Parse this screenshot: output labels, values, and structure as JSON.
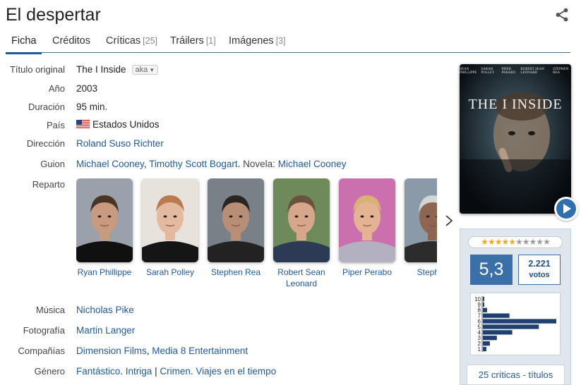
{
  "title": "El despertar",
  "tabs": [
    {
      "label": "Ficha",
      "count": ""
    },
    {
      "label": "Créditos",
      "count": ""
    },
    {
      "label": "Críticas",
      "count": "[25]"
    },
    {
      "label": "Tráilers",
      "count": "[1]"
    },
    {
      "label": "Imágenes",
      "count": "[3]"
    }
  ],
  "labels": {
    "original_title": "Título original",
    "year": "Año",
    "duration": "Duración",
    "country": "País",
    "director": "Dirección",
    "screenplay": "Guion",
    "cast": "Reparto",
    "music": "Música",
    "photography": "Fotografía",
    "companies": "Compañías",
    "genre": "Género"
  },
  "values": {
    "original_title": "The I Inside",
    "aka_label": "aka",
    "year": "2003",
    "duration": "95 min.",
    "country": "Estados Unidos",
    "director": "Roland Suso Richter",
    "screenplay_writers": [
      "Michael Cooney",
      "Timothy Scott Bogart"
    ],
    "novel_label": "Novela:",
    "novel_author": "Michael Cooney",
    "music": "Nicholas Pike",
    "photography": "Martin Langer",
    "companies": [
      "Dimension Films",
      "Media 8 Entertainment"
    ],
    "genre_a": [
      "Fantástico",
      "Intriga"
    ],
    "genre_b": [
      "Crimen",
      "Viajes en el tiempo"
    ]
  },
  "cast": [
    {
      "name": "Ryan Phillippe",
      "skin": "#c89a80",
      "hair": "#4a3426",
      "bg": "#9aa1ab",
      "shirt": "#101010"
    },
    {
      "name": "Sarah Polley",
      "skin": "#e3b9a0",
      "hair": "#b87a4e",
      "bg": "#e7e2dc",
      "shirt": "#151515"
    },
    {
      "name": "Stephen Rea",
      "skin": "#b88e76",
      "hair": "#2a2522",
      "bg": "#7a8088",
      "shirt": "#222222"
    },
    {
      "name": "Robert Sean Leonard",
      "skin": "#d6a78b",
      "hair": "#6a5140",
      "bg": "#6f8a5a",
      "shirt": "#2d3a55"
    },
    {
      "name": "Piper Perabo",
      "skin": "#e4b394",
      "hair": "#d7b273",
      "bg": "#cc6fae",
      "shirt": "#b3b0c2"
    },
    {
      "name": "Stephen",
      "skin": "#8d6550",
      "hair": "#d5d5d5",
      "bg": "#8a9aa8",
      "shirt": "#2c2c2c"
    }
  ],
  "poster": {
    "tagline": "THE I INSIDE",
    "credits": [
      "RYAN PHILLIPPE",
      "SARAH POLLEY",
      "PIPER PERABO",
      "ROBERT SEAN LEONARD",
      "STEPHEN REA"
    ]
  },
  "rating": {
    "average": "5,3",
    "votes": "2.221",
    "votes_label": "votos",
    "stars_filled": 5,
    "stars_total": 10,
    "histogram": {
      "labels": [
        "10",
        "9",
        "8",
        "7",
        "6",
        "5",
        "4",
        "3",
        "2",
        "1"
      ],
      "values": [
        2,
        2,
        6,
        38,
        105,
        80,
        42,
        20,
        10,
        5
      ]
    },
    "critics_link": "25 críticas - títulos"
  },
  "colors": {
    "link": "#1f5aa0",
    "accent": "#3a6fa8",
    "panel": "#dfe6ee"
  }
}
